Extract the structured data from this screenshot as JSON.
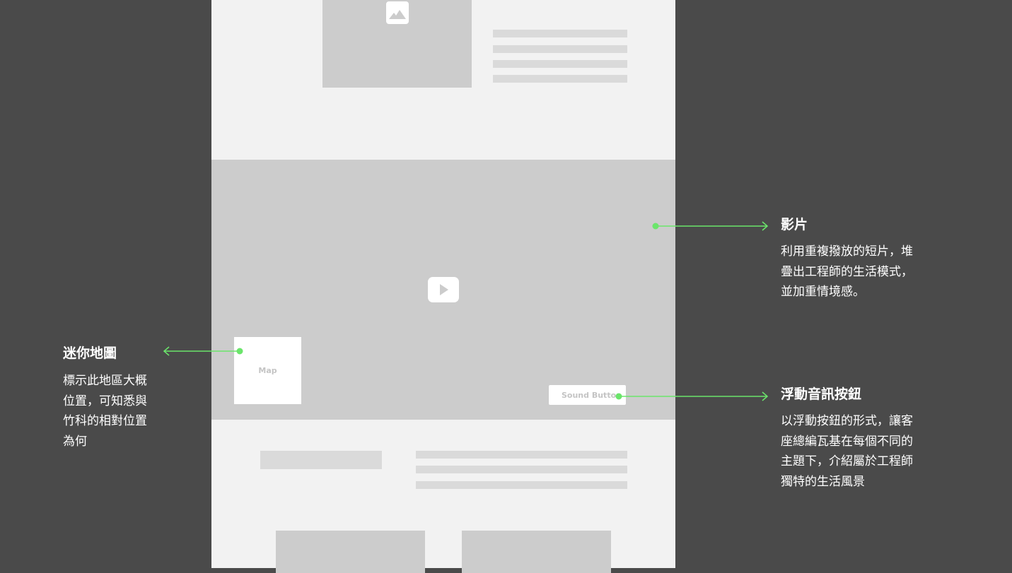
{
  "wireframe": {
    "map_label": "Map",
    "sound_button_label": "Sound Button",
    "icons": {
      "image": "image-placeholder-icon",
      "play": "play-icon"
    }
  },
  "annotations": {
    "video": {
      "title": "影片",
      "lines": [
        "利用重複撥放的短片，堆",
        "疊出工程師的生活模式，",
        "並加重情境感。"
      ]
    },
    "minimap": {
      "title": "迷你地圖",
      "lines": [
        "標示此地區大概",
        "位置，可知悉與",
        "竹科的相對位置",
        "為何"
      ]
    },
    "sound_button": {
      "title": "浮動音訊按鈕",
      "lines": [
        "以浮動按鈕的形式，讓客",
        "座總編瓦基在每個不同的",
        "主題下，介紹屬於工程師",
        "獨特的生活風景"
      ]
    }
  },
  "colors": {
    "background": "#4a4a4a",
    "page": "#f2f2f2",
    "placeholder": "#cccccc",
    "accent": "#6be56b"
  }
}
